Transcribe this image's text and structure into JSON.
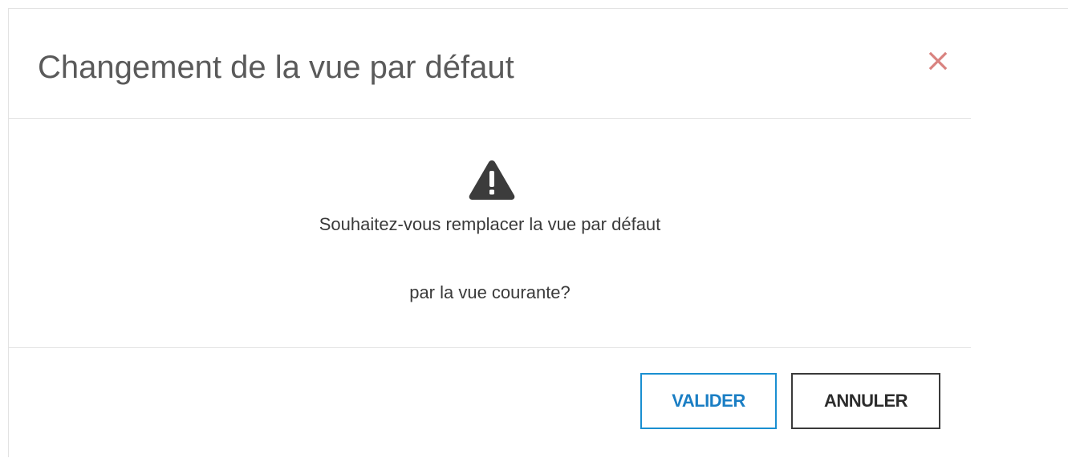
{
  "dialog": {
    "title": "Changement de la vue par défaut",
    "close_icon": "close-icon",
    "close_color": "#d9827f",
    "warning_icon": "warning-icon",
    "message_line1": "Souhaitez-vous remplacer la vue par défaut",
    "message_line2": "par la vue courante?",
    "buttons": {
      "validate_label": "VALIDER",
      "validate_color": "#1a8fd1",
      "cancel_label": "ANNULER",
      "cancel_color": "#3a3a3a"
    }
  }
}
